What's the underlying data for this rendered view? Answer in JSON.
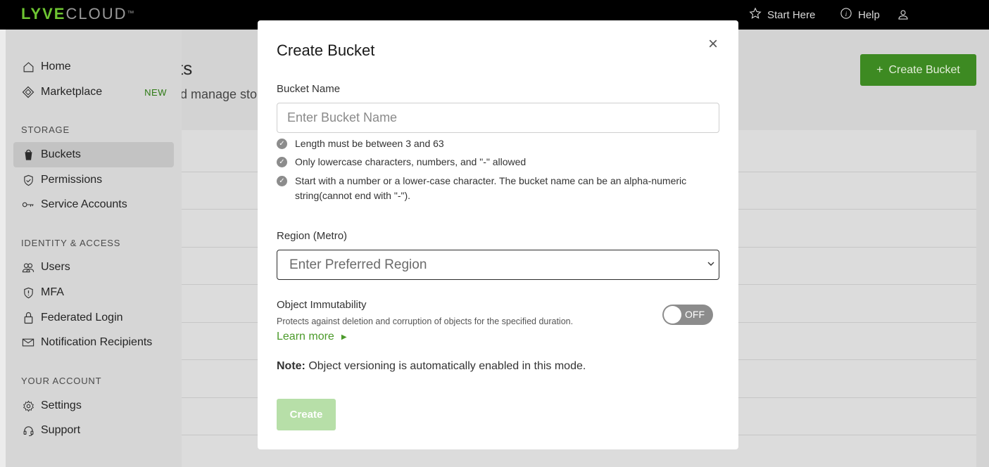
{
  "brand": {
    "part1": "LYVE",
    "part2": "CLOUD",
    "tm": "™"
  },
  "topnav": {
    "start_here": "Start Here",
    "help": "Help"
  },
  "page": {
    "title": "ts",
    "subtitle": "d manage sto",
    "create_button": "Create Bucket"
  },
  "sidebar": {
    "home": "Home",
    "marketplace": "Marketplace",
    "new_badge": "NEW",
    "storage_heading": "STORAGE",
    "buckets": "Buckets",
    "permissions": "Permissions",
    "service_accounts": "Service Accounts",
    "identity_heading": "IDENTITY & ACCESS",
    "users": "Users",
    "mfa": "MFA",
    "federated_login": "Federated Login",
    "notification_recipients": "Notification Recipients",
    "account_heading": "YOUR ACCOUNT",
    "settings": "Settings",
    "support": "Support"
  },
  "modal": {
    "title": "Create Bucket",
    "close": "×",
    "bucket_name_label": "Bucket Name",
    "bucket_name_placeholder": "Enter Bucket Name",
    "bucket_name_value": "",
    "rules": [
      "Length must be between 3 and 63",
      "Only lowercase characters, numbers, and \"-\" allowed",
      "Start with a number or a lower-case character. The bucket name can be an alpha-numeric string(cannot end with \"-\")."
    ],
    "region_label": "Region (Metro)",
    "region_selected": "Enter Preferred Region",
    "immutability_label": "Object Immutability",
    "immutability_desc": "Protects against deletion and corruption of objects for the specified duration.",
    "learn_more": "Learn more",
    "toggle_state": "OFF",
    "note_prefix": "Note:",
    "note_text": " Object versioning is automatically enabled in this mode.",
    "create_button": "Create"
  },
  "colors": {
    "brand_green": "#6ec532",
    "button_green": "#3d8a22",
    "disabled_green": "#b7dfa8",
    "link_green": "#4b9a2a"
  }
}
